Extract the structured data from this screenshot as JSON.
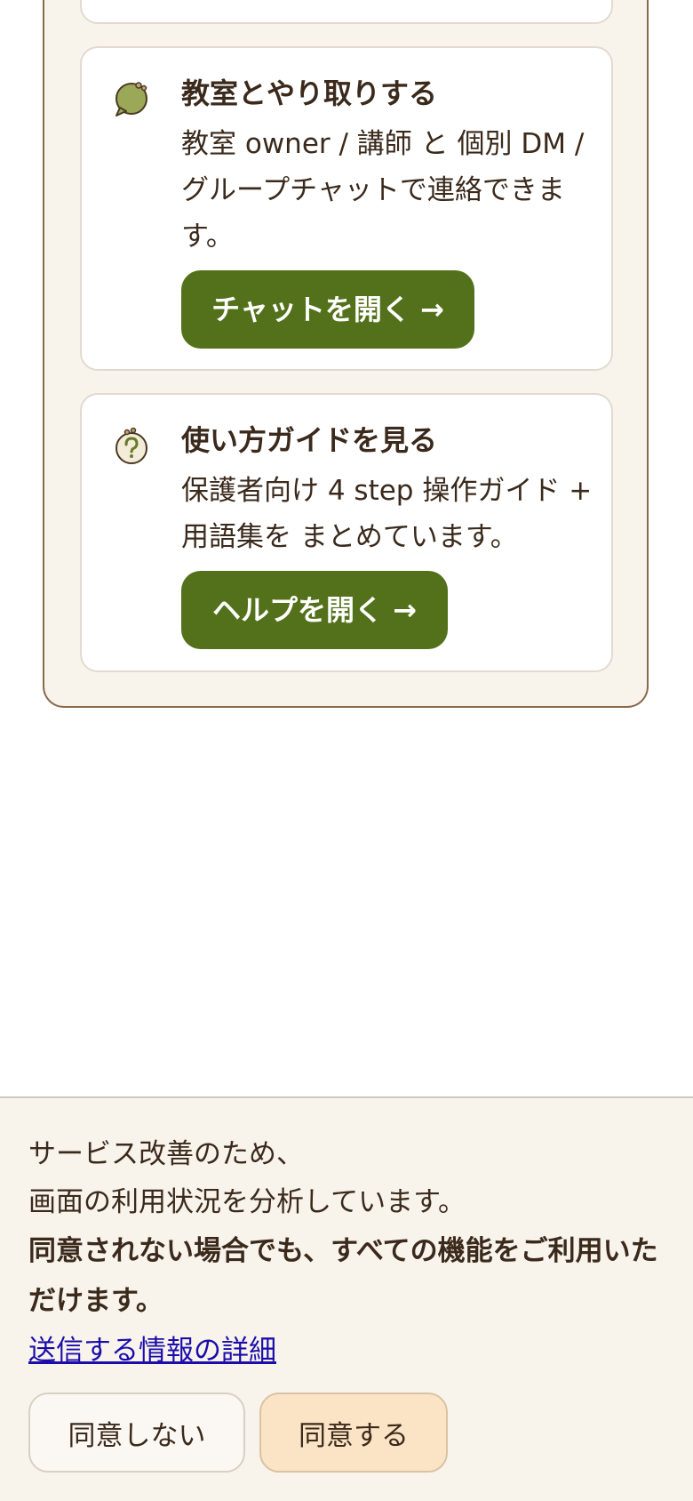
{
  "cards": {
    "chat": {
      "icon": "speech-bubble-icon",
      "title": "教室とやり取りする",
      "description": "教室 owner / 講師 と 個別 DM / グループチャットで連絡できます。",
      "button_label": "チャットを開く →"
    },
    "help": {
      "icon": "question-mark-icon",
      "title": "使い方ガイドを見る",
      "description": "保護者向け 4 step 操作ガイド + 用語集を まとめています。",
      "button_label": "ヘルプを開く →"
    }
  },
  "consent": {
    "line1": "サービス改善のため、",
    "line2": "画面の利用状況を分析しています。",
    "notice": "同意されない場合でも、すべての機能をご利用いただけます。",
    "details_link": "送信する情報の詳細",
    "decline_label": "同意しない",
    "accept_label": "同意する"
  },
  "colors": {
    "accent_green": "#53711b",
    "panel_bg": "#f8f4ec",
    "accept_bg": "#fbe3c5",
    "link": "#1a0dab"
  }
}
